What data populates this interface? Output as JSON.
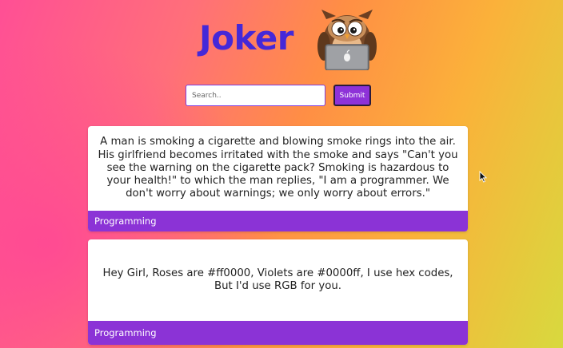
{
  "header": {
    "logo_text": "Joker",
    "mascot_icon": "owl-with-laptop-icon"
  },
  "search": {
    "placeholder": "Search..",
    "value": "",
    "submit_label": "Submit"
  },
  "jokes": [
    {
      "text": "A man is smoking a cigarette and blowing smoke rings into the air. His girlfriend becomes irritated with the smoke and says \"Can't you see the warning on the cigarette pack? Smoking is hazardous to your health!\" to which the man replies, \"I am a programmer. We don't worry about warnings; we only worry about errors.\"",
      "category": "Programming"
    },
    {
      "text": "Hey Girl, Roses are #ff0000, Violets are #0000ff, I use hex codes, But I'd use RGB for you.",
      "category": "Programming"
    }
  ],
  "colors": {
    "accent": "#8b33d6",
    "logo": "#4528d8"
  }
}
